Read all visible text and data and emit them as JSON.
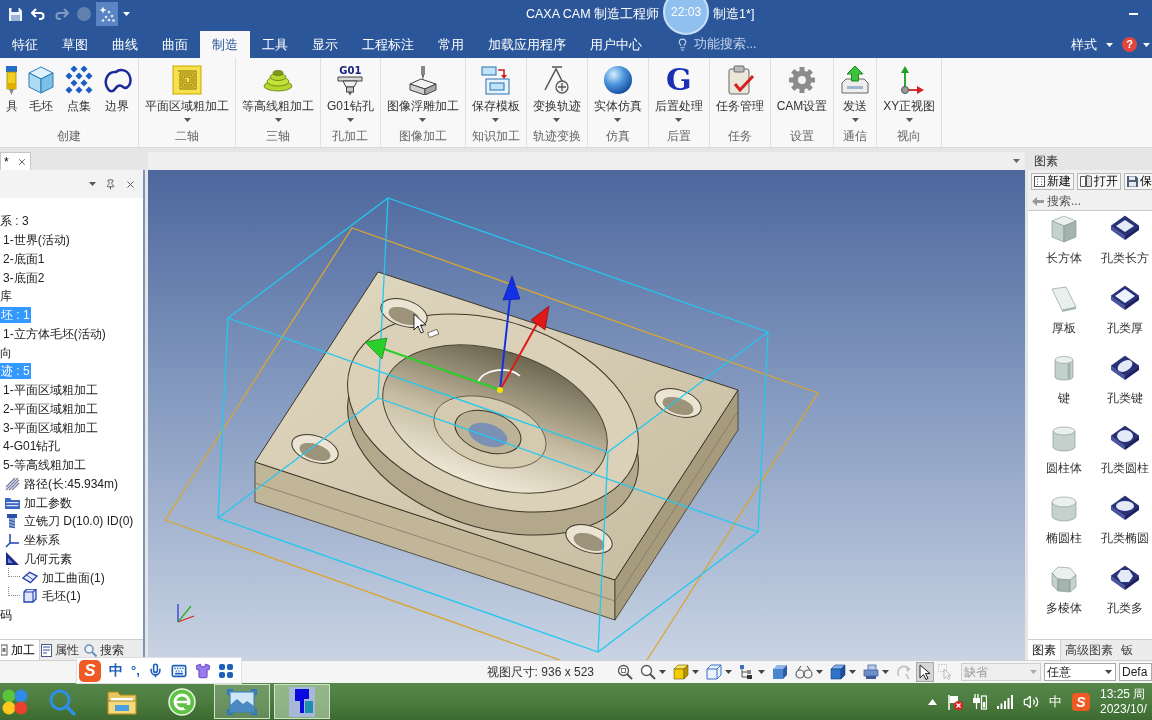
{
  "title_bar": {
    "quick_access": [
      {
        "selected": false,
        "disabled": false
      },
      {
        "selected": false,
        "disabled": false
      },
      {
        "selected": false,
        "disabled": true
      },
      {
        "selected": false,
        "disabled": true
      },
      {
        "selected": true,
        "disabled": false
      }
    ],
    "title": "CAXA CAM 制造工程师",
    "title_tail": "制造1*]",
    "recording_timer": "22:03"
  },
  "ribbon_tabs": [
    {
      "label": "特征",
      "selected": false
    },
    {
      "label": "草图",
      "selected": false
    },
    {
      "label": "曲线",
      "selected": false
    },
    {
      "label": "曲面",
      "selected": false
    },
    {
      "label": "制造",
      "selected": true
    },
    {
      "label": "工具",
      "selected": false
    },
    {
      "label": "显示",
      "selected": false
    },
    {
      "label": "工程标注",
      "selected": false
    },
    {
      "label": "常用",
      "selected": false
    },
    {
      "label": "加载应用程序",
      "selected": false
    },
    {
      "label": "用户中心",
      "selected": false
    }
  ],
  "feature_search": {
    "placeholder": "功能搜索..."
  },
  "style_menu": {
    "label": "样式"
  },
  "help_button": {
    "label": "?"
  },
  "ribbon_groups": [
    {
      "label": "创建",
      "buttons": [
        {
          "label": "具",
          "dropdown": false
        },
        {
          "label": "毛坯",
          "dropdown": false
        },
        {
          "label": "点集",
          "dropdown": false
        },
        {
          "label": "边界",
          "dropdown": false
        }
      ]
    },
    {
      "label": "二轴",
      "buttons": [
        {
          "label": "平面区域粗加工",
          "dropdown": true
        }
      ]
    },
    {
      "label": "三轴",
      "buttons": [
        {
          "label": "等高线粗加工",
          "dropdown": true
        }
      ]
    },
    {
      "label": "孔加工",
      "buttons": [
        {
          "label": "G01钻孔",
          "icon_text": "G01",
          "dropdown": true
        }
      ]
    },
    {
      "label": "图像加工",
      "buttons": [
        {
          "label": "图像浮雕加工",
          "dropdown": true
        }
      ]
    },
    {
      "label": "知识加工",
      "buttons": [
        {
          "label": "保存模板",
          "dropdown": true
        }
      ]
    },
    {
      "label": "轨迹变换",
      "buttons": [
        {
          "label": "变换轨迹",
          "dropdown": true
        }
      ]
    },
    {
      "label": "仿真",
      "buttons": [
        {
          "label": "实体仿真",
          "dropdown": true
        }
      ]
    },
    {
      "label": "后置",
      "buttons": [
        {
          "label": "后置处理",
          "icon_text": "G",
          "dropdown": true
        }
      ]
    },
    {
      "label": "任务",
      "buttons": [
        {
          "label": "任务管理",
          "dropdown": false
        }
      ]
    },
    {
      "label": "设置",
      "buttons": [
        {
          "label": "CAM设置",
          "dropdown": false
        }
      ]
    },
    {
      "label": "通信",
      "buttons": [
        {
          "label": "发送",
          "dropdown": true
        }
      ]
    },
    {
      "label": "视向",
      "buttons": [
        {
          "label": "XY正视图",
          "dropdown": true
        }
      ]
    }
  ],
  "left_panel": {
    "tab_label": "*",
    "tree": [
      {
        "label": "系 : 3",
        "selected": false,
        "children": [
          {
            "label": "1-世界(活动)",
            "selected": false
          },
          {
            "label": "2-底面1",
            "selected": false
          },
          {
            "label": "3-底面2",
            "selected": false
          }
        ]
      },
      {
        "label": "库",
        "selected": false
      },
      {
        "label": "坯 : 1",
        "selected": true,
        "children": [
          {
            "label": "1-立方体毛坯(活动)",
            "selected": false
          }
        ]
      },
      {
        "label": "向",
        "selected": false
      },
      {
        "label": "迹 : 5",
        "selected": true,
        "children": [
          {
            "label": "1-平面区域粗加工",
            "selected": false
          },
          {
            "label": "2-平面区域粗加工",
            "selected": false
          },
          {
            "label": "3-平面区域粗加工",
            "selected": false
          },
          {
            "label": "4-G01钻孔",
            "selected": false
          },
          {
            "label": "5-等高线粗加工",
            "selected": false,
            "children": [
              {
                "label": "路径(长:45.934m)",
                "selected": false
              },
              {
                "label": "加工参数",
                "selected": false
              },
              {
                "label": "立铣刀 D(10.0) ID(0)",
                "selected": false
              },
              {
                "label": "坐标系",
                "selected": false
              },
              {
                "label": "几何元素",
                "selected": false,
                "children": [
                  {
                    "label": "加工曲面(1)",
                    "selected": false
                  },
                  {
                    "label": "毛坯(1)",
                    "selected": false
                  }
                ]
              }
            ]
          }
        ]
      },
      {
        "label": "码",
        "selected": false
      }
    ],
    "tabs": [
      {
        "label": "加工",
        "selected": true
      },
      {
        "label": "属性",
        "selected": false
      },
      {
        "label": "搜索",
        "selected": false
      }
    ]
  },
  "right_panel": {
    "title": "图素",
    "toolbar": [
      "新建",
      "打开",
      "保"
    ],
    "search": {
      "placeholder": "搜索..."
    },
    "items": [
      {
        "label": "长方体"
      },
      {
        "label": "孔类长方"
      },
      {
        "label": "厚板"
      },
      {
        "label": "孔类厚"
      },
      {
        "label": "键"
      },
      {
        "label": "孔类键"
      },
      {
        "label": "圆柱体"
      },
      {
        "label": "孔类圆柱"
      },
      {
        "label": "椭圆柱"
      },
      {
        "label": "孔类椭圆"
      },
      {
        "label": "多棱体"
      },
      {
        "label": "孔类多"
      }
    ],
    "tabs": [
      {
        "label": "图素",
        "selected": true
      },
      {
        "label": "高级图素",
        "selected": false
      },
      {
        "label": "钣",
        "selected": false
      }
    ]
  },
  "status_bar": {
    "view_size": "视图尺寸: 936 x 523",
    "tools": [
      {
        "dropdown": false,
        "selected": false,
        "disabled": false
      },
      {
        "dropdown": true,
        "selected": false,
        "disabled": false
      },
      {
        "dropdown": true,
        "selected": false,
        "disabled": false
      },
      {
        "dropdown": true,
        "selected": false,
        "disabled": false
      },
      {
        "dropdown": true,
        "selected": false,
        "disabled": false
      },
      {
        "dropdown": false,
        "selected": false,
        "disabled": false
      },
      {
        "dropdown": true,
        "selected": false,
        "disabled": false
      },
      {
        "dropdown": true,
        "selected": false,
        "disabled": false
      },
      {
        "dropdown": true,
        "selected": false,
        "disabled": false
      },
      {
        "dropdown": false,
        "selected": false,
        "disabled": true
      },
      {
        "dropdown": false,
        "selected": true,
        "disabled": false
      },
      {
        "dropdown": false,
        "selected": false,
        "disabled": true
      }
    ],
    "dropdowns": [
      {
        "value": "缺省",
        "disabled": true
      },
      {
        "value": "任意",
        "disabled": false
      },
      {
        "value": "Defa",
        "disabled": false
      }
    ]
  },
  "ime_toolbar": {
    "logo": "S",
    "mode": "中",
    "punctuation": "°,"
  },
  "taskbar": {
    "apps": [
      {
        "running": false,
        "selected": false
      },
      {
        "running": false,
        "selected": false
      },
      {
        "running": false,
        "selected": false
      },
      {
        "running": true,
        "selected": false
      },
      {
        "running": true,
        "selected": true
      }
    ],
    "tray": {
      "ime_mode": "中",
      "ime_logo": "S",
      "time": "13:25 周",
      "date": "2023/10/"
    }
  }
}
